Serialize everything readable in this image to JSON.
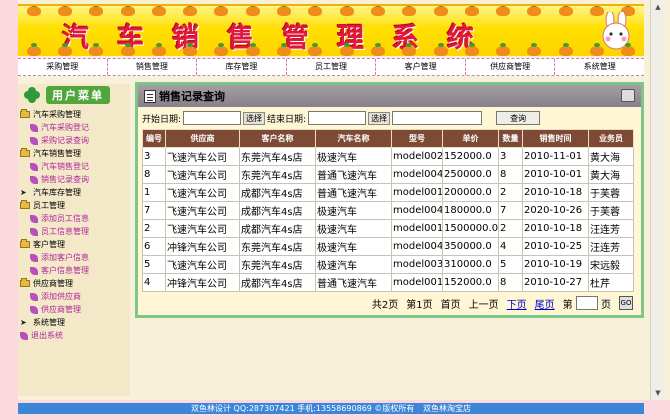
{
  "banner": {
    "title": "汽车销售管理系统"
  },
  "nav": {
    "items": [
      "采购管理",
      "销售管理",
      "库存管理",
      "员工管理",
      "客户管理",
      "供应商管理",
      "系统管理"
    ]
  },
  "sidebar": {
    "title": "用户菜单",
    "groups": [
      {
        "label": "汽车采购管理",
        "items": [
          "汽车采购登记",
          "采购记录查询"
        ]
      },
      {
        "label": "汽车销售管理",
        "items": [
          "汽车销售登记",
          "销售记录查询"
        ]
      },
      {
        "label": "汽车库存管理",
        "items": []
      },
      {
        "label": "员工管理",
        "items": [
          "添加员工信息",
          "员工信息管理"
        ]
      },
      {
        "label": "客户管理",
        "items": [
          "添加客户信息",
          "客户信息管理"
        ]
      },
      {
        "label": "供应商管理",
        "items": [
          "添加供应商",
          "供应商管理"
        ]
      },
      {
        "label": "系统管理",
        "items": []
      },
      {
        "label": "退出系统",
        "items": []
      }
    ]
  },
  "panel": {
    "title": "销售记录查询",
    "start_label": "开始日期:",
    "end_label": "结束日期:",
    "pick_label": "选择",
    "query_label": "查询",
    "columns": [
      "编号",
      "供应商",
      "客户名称",
      "汽车名称",
      "型号",
      "单价",
      "数量",
      "销售时间",
      "业务员"
    ],
    "rows": [
      [
        "3",
        "飞速汽车公司",
        "东莞汽车4s店",
        "极速汽车",
        "model002",
        "152000.0",
        "3",
        "2010-11-01",
        "黄大海"
      ],
      [
        "8",
        "飞速汽车公司",
        "东莞汽车4s店",
        "普通飞速汽车",
        "model004",
        "250000.0",
        "8",
        "2010-10-01",
        "黄大海"
      ],
      [
        "1",
        "飞速汽车公司",
        "成都汽车4s店",
        "普通飞速汽车",
        "model001",
        "200000.0",
        "2",
        "2010-10-18",
        "于芙蓉"
      ],
      [
        "7",
        "飞速汽车公司",
        "成都汽车4s店",
        "极速汽车",
        "model004",
        "180000.0",
        "7",
        "2020-10-26",
        "于芙蓉"
      ],
      [
        "2",
        "飞速汽车公司",
        "成都汽车4s店",
        "极速汽车",
        "model001",
        "1500000.0",
        "2",
        "2010-10-18",
        "汪连芳"
      ],
      [
        "6",
        "冲锋汽车公司",
        "东莞汽车4s店",
        "极速汽车",
        "model004",
        "350000.0",
        "4",
        "2010-10-25",
        "汪连芳"
      ],
      [
        "5",
        "飞速汽车公司",
        "东莞汽车4s店",
        "极速汽车",
        "model003",
        "310000.0",
        "5",
        "2010-10-19",
        "宋远毅"
      ],
      [
        "4",
        "冲锋汽车公司",
        "成都汽车4s店",
        "普通飞速汽车",
        "model001",
        "152000.0",
        "8",
        "2010-10-27",
        "杜芹"
      ]
    ]
  },
  "pager": {
    "total": "共2页",
    "current": "第1页",
    "first": "首页",
    "prev": "上一页",
    "next": "下页",
    "last": "尾页",
    "goto_prefix": "第",
    "goto_suffix": "页",
    "go_label": "GO"
  },
  "footer": {
    "text": "双鱼林设计  QQ:287307421 手机:13558690869 ©版权所有",
    "link": "双鱼林淘宝店"
  }
}
